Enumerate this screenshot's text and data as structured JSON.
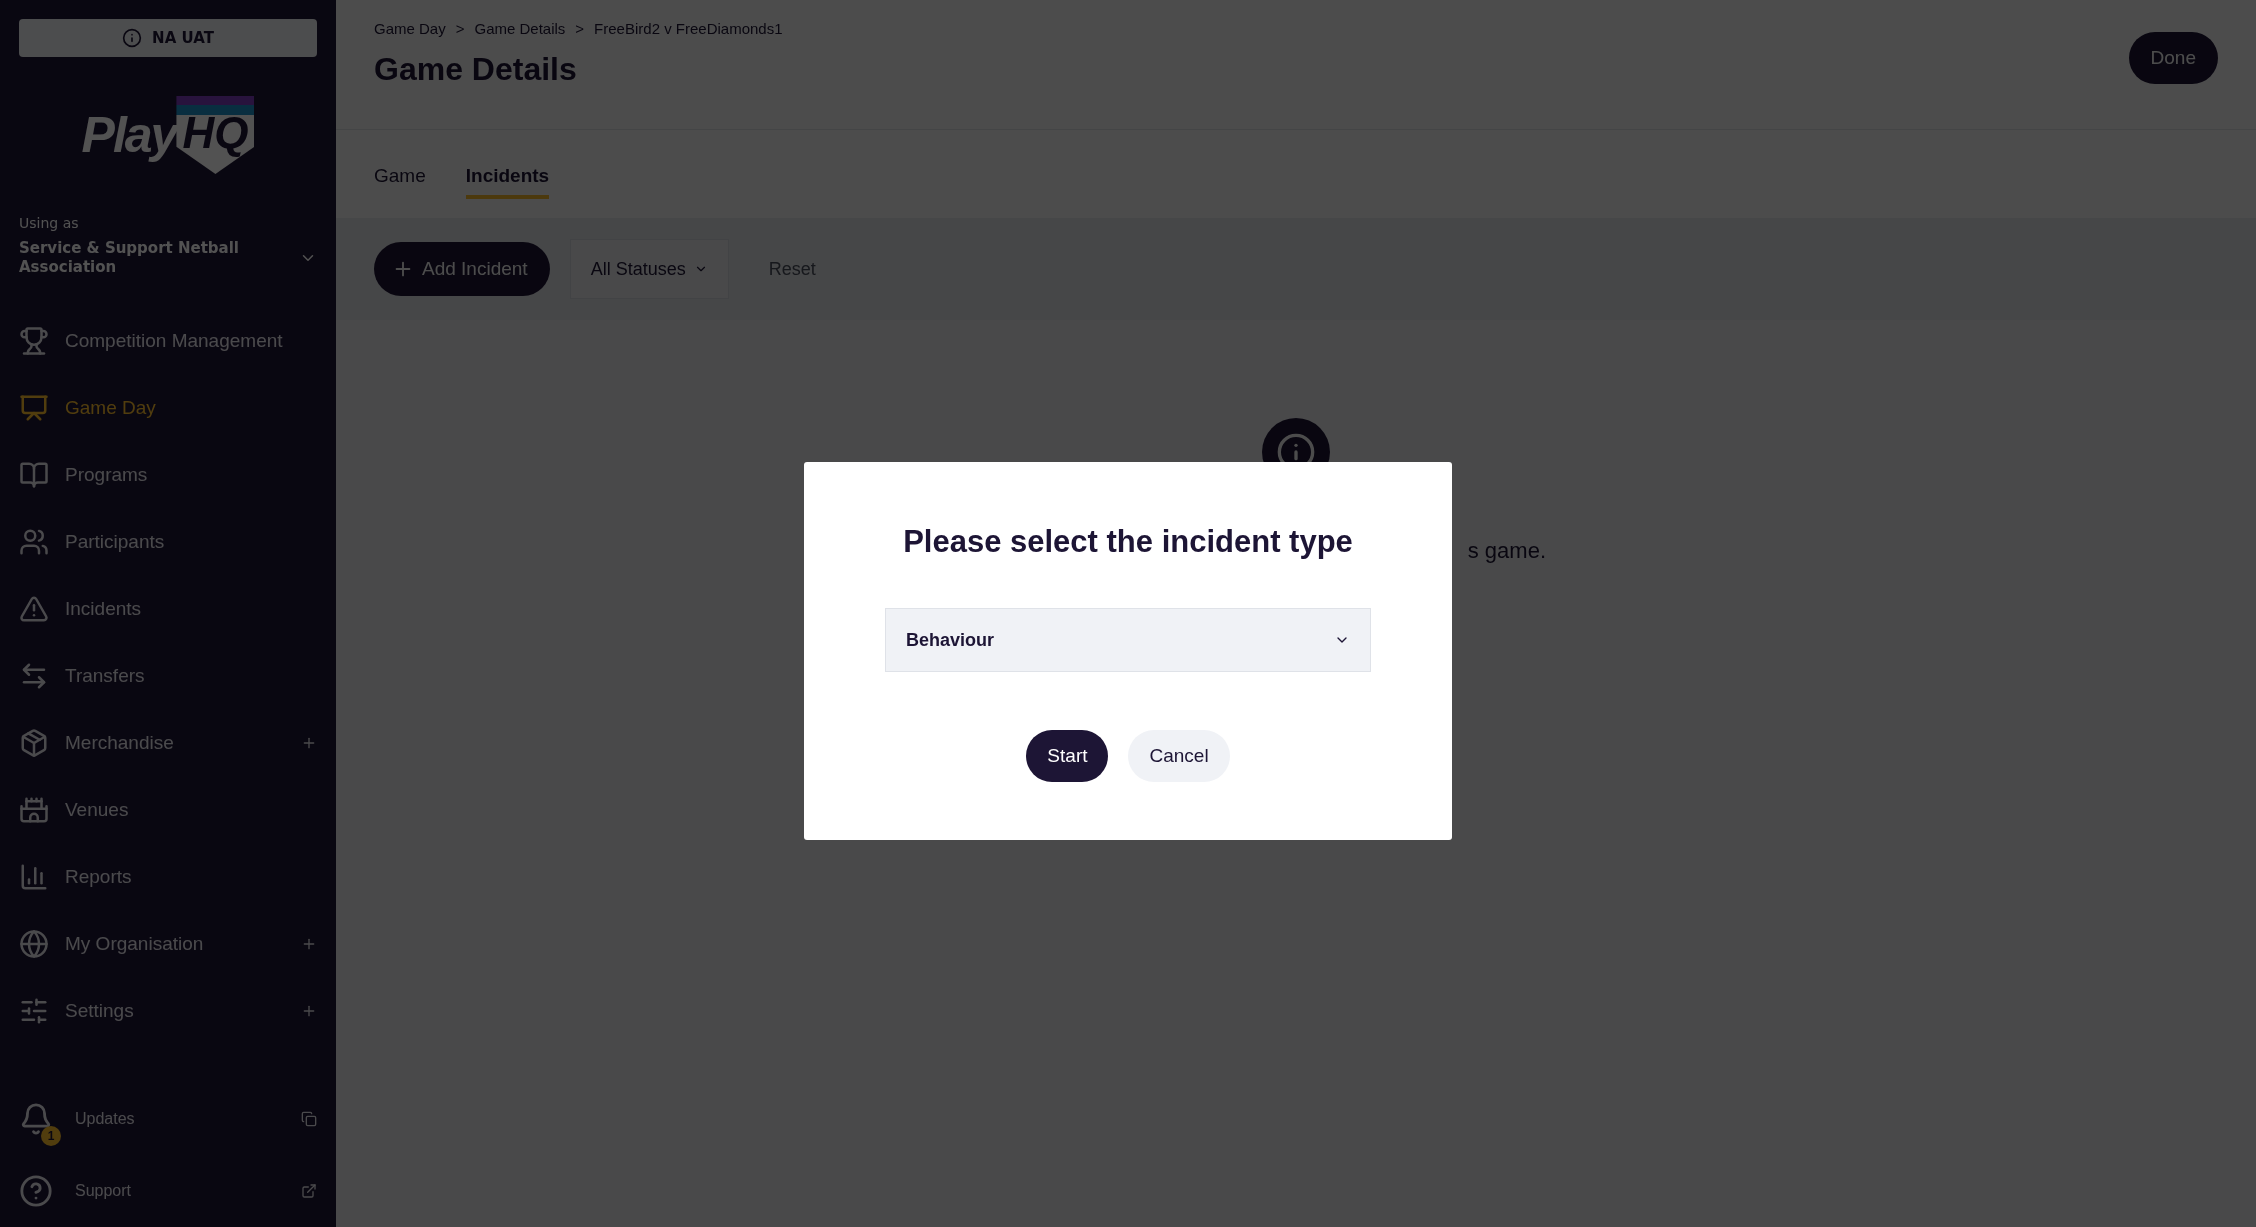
{
  "sidebar": {
    "environment_badge": "NA UAT",
    "logo": {
      "word": "Play",
      "mark": "HQ"
    },
    "using_as": {
      "label": "Using as",
      "organisation": "Service & Support Netball Association"
    },
    "items": [
      {
        "label": "Competition Management",
        "selected": false,
        "expandable": false
      },
      {
        "label": "Game Day",
        "selected": true,
        "expandable": false
      },
      {
        "label": "Programs",
        "selected": false,
        "expandable": false
      },
      {
        "label": "Participants",
        "selected": false,
        "expandable": false
      },
      {
        "label": "Incidents",
        "selected": false,
        "expandable": false
      },
      {
        "label": "Transfers",
        "selected": false,
        "expandable": false
      },
      {
        "label": "Merchandise",
        "selected": false,
        "expandable": true
      },
      {
        "label": "Venues",
        "selected": false,
        "expandable": false
      },
      {
        "label": "Reports",
        "selected": false,
        "expandable": false
      },
      {
        "label": "My Organisation",
        "selected": false,
        "expandable": true
      },
      {
        "label": "Settings",
        "selected": false,
        "expandable": true
      }
    ],
    "footer": [
      {
        "label": "Updates",
        "badge": "1"
      },
      {
        "label": "Support"
      }
    ]
  },
  "header": {
    "breadcrumb": [
      "Game Day",
      "Game Details",
      "FreeBird2 v FreeDiamonds1"
    ],
    "separator": ">",
    "title": "Game Details",
    "done_button": "Done"
  },
  "tabs": [
    {
      "label": "Game",
      "selected": false
    },
    {
      "label": "Incidents",
      "selected": true
    }
  ],
  "toolbar": {
    "add_button": "Add Incident",
    "status_filter": "All Statuses",
    "reset": {
      "label": "Reset",
      "disabled": true
    }
  },
  "empty_state": {
    "text": "s game."
  },
  "modal": {
    "title": "Please select the incident type",
    "select": {
      "value": "Behaviour"
    },
    "buttons": [
      {
        "label": "Start",
        "kind": "primary"
      },
      {
        "label": "Cancel",
        "kind": "secondary"
      }
    ]
  }
}
